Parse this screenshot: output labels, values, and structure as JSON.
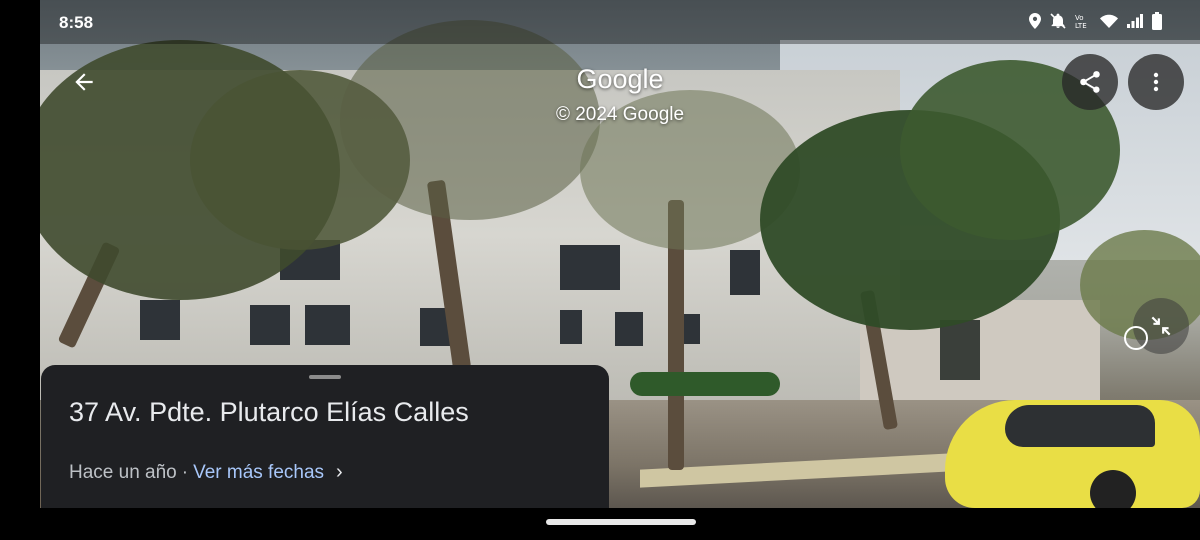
{
  "status": {
    "time": "8:58",
    "icons": [
      "location-icon",
      "bell-off-icon",
      "volte-icon",
      "wifi-icon",
      "signal-icon",
      "battery-icon"
    ]
  },
  "viewer": {
    "title": "Google",
    "copyright": "© 2024 Google"
  },
  "card": {
    "address": "37 Av. Pdte. Plutarco Elías Calles",
    "date": "Hace un año",
    "separator": "·",
    "more_dates": "Ver más fechas",
    "chevron": "›"
  },
  "colors": {
    "card_bg": "#1f2023",
    "link": "#a8c7fa"
  }
}
